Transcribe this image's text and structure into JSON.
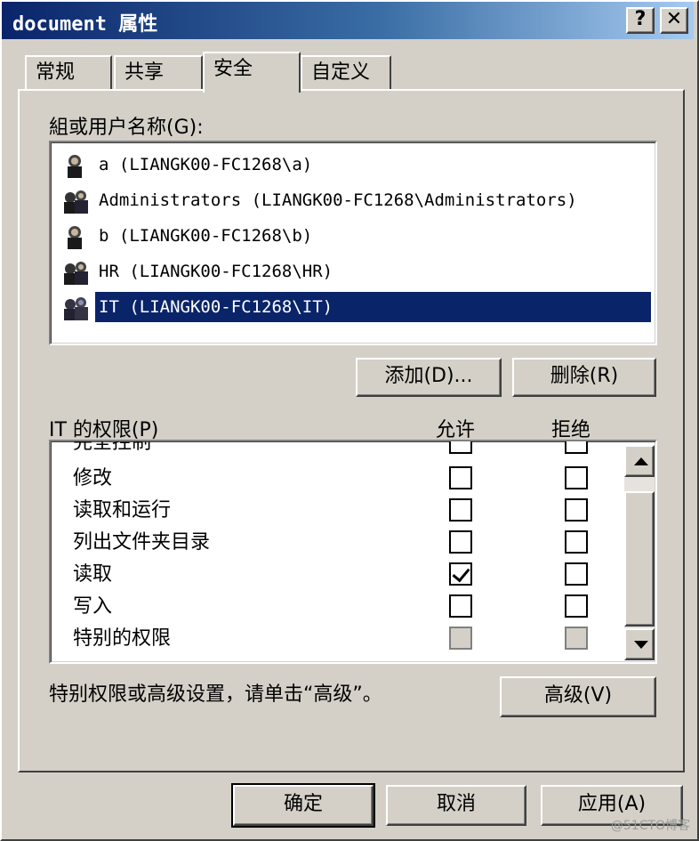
{
  "window": {
    "title": "document 属性"
  },
  "title_buttons": {
    "help": "?",
    "close": "✕"
  },
  "tabs": [
    {
      "label": "常规"
    },
    {
      "label": "共享"
    },
    {
      "label": "安全"
    },
    {
      "label": "自定义"
    }
  ],
  "groups": {
    "label_prefix": "組或用户名称",
    "label_hotkey": "(G)",
    "label_suffix": ":",
    "items": [
      {
        "label": "a (LIANGK00-FC1268\\a)",
        "icon": "user-icon"
      },
      {
        "label": "Administrators (LIANGK00-FC1268\\Administrators)",
        "icon": "user-group-icon"
      },
      {
        "label": "b (LIANGK00-FC1268\\b)",
        "icon": "user-icon"
      },
      {
        "label": "HR (LIANGK00-FC1268\\HR)",
        "icon": "user-group-icon"
      },
      {
        "label": "IT (LIANGK00-FC1268\\IT)",
        "icon": "user-group-icon",
        "selected": true
      }
    ]
  },
  "buttons": {
    "add": "添加(D)...",
    "remove": "删除(R)",
    "advanced": "高级(V)",
    "ok": "确定",
    "cancel": "取消",
    "apply": "应用(A)"
  },
  "permissions": {
    "label_prefix": "IT 的权限",
    "label_hotkey": "(P)",
    "allow_header": "允许",
    "deny_header": "拒绝",
    "items": [
      {
        "name": "完全控制",
        "allow": false,
        "deny": false
      },
      {
        "name": "修改",
        "allow": false,
        "deny": false
      },
      {
        "name": "读取和运行",
        "allow": false,
        "deny": false
      },
      {
        "name": "列出文件夹目录",
        "allow": false,
        "deny": false
      },
      {
        "name": "读取",
        "allow": true,
        "deny": false
      },
      {
        "name": "写入",
        "allow": false,
        "deny": false
      },
      {
        "name": "特别的权限",
        "allow": false,
        "deny": false,
        "disabled": true
      }
    ]
  },
  "advanced_hint": "特别权限或高级设置，请单击“高级”。",
  "watermark": "@51CTO博客"
}
